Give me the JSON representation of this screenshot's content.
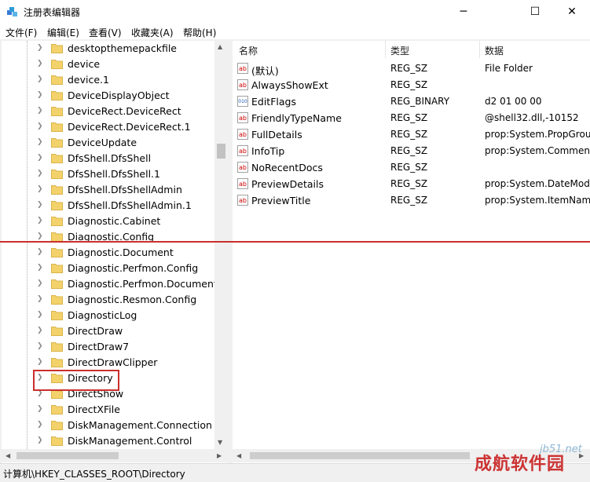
{
  "window": {
    "title": "注册表编辑器",
    "minimize_glyph": "─",
    "maximize_glyph": "☐",
    "close_glyph": "✕"
  },
  "menu": [
    "文件(F)",
    "编辑(E)",
    "查看(V)",
    "收藏夹(A)",
    "帮助(H)"
  ],
  "tree": {
    "items": [
      "desktopthemepackfile",
      "device",
      "device.1",
      "DeviceDisplayObject",
      "DeviceRect.DeviceRect",
      "DeviceRect.DeviceRect.1",
      "DeviceUpdate",
      "DfsShell.DfsShell",
      "DfsShell.DfsShell.1",
      "DfsShell.DfsShellAdmin",
      "DfsShell.DfsShellAdmin.1",
      "Diagnostic.Cabinet",
      "Diagnostic.Config",
      "Diagnostic.Document",
      "Diagnostic.Perfmon.Config",
      "Diagnostic.Perfmon.Document",
      "Diagnostic.Resmon.Config",
      "DiagnosticLog",
      "DirectDraw",
      "DirectDraw7",
      "DirectDrawClipper",
      "Directory",
      "DirectShow",
      "DirectXFile",
      "DiskManagement.Connection",
      "DiskManagement.Control"
    ],
    "selected": "Directory",
    "arrow_glyph": "❯"
  },
  "columns": {
    "name": "名称",
    "type": "类型",
    "data": "数据"
  },
  "values": [
    {
      "name": "(默认)",
      "type": "REG_SZ",
      "data": "File Folder",
      "icon": "ab"
    },
    {
      "name": "AlwaysShowExt",
      "type": "REG_SZ",
      "data": "",
      "icon": "ab"
    },
    {
      "name": "EditFlags",
      "type": "REG_BINARY",
      "data": "d2 01 00 00",
      "icon": "010"
    },
    {
      "name": "FriendlyTypeName",
      "type": "REG_SZ",
      "data": "@shell32.dll,-10152",
      "icon": "ab"
    },
    {
      "name": "FullDetails",
      "type": "REG_SZ",
      "data": "prop:System.PropGrou",
      "icon": "ab"
    },
    {
      "name": "InfoTip",
      "type": "REG_SZ",
      "data": "prop:System.Comment",
      "icon": "ab"
    },
    {
      "name": "NoRecentDocs",
      "type": "REG_SZ",
      "data": "",
      "icon": "ab"
    },
    {
      "name": "PreviewDetails",
      "type": "REG_SZ",
      "data": "prop:System.DateMod",
      "icon": "ab"
    },
    {
      "name": "PreviewTitle",
      "type": "REG_SZ",
      "data": "prop:System.ItemNam",
      "icon": "ab"
    }
  ],
  "status": {
    "path": "计算机\\HKEY_CLASSES_ROOT\\Directory"
  },
  "watermark": {
    "site": "jb51.net",
    "brand": "成航软件园"
  },
  "colors": {
    "annotation": "#c9302c",
    "folder": "#f4d26b"
  },
  "scroll": {
    "up": "▲",
    "down": "▼",
    "left": "◀",
    "right": "▶"
  }
}
